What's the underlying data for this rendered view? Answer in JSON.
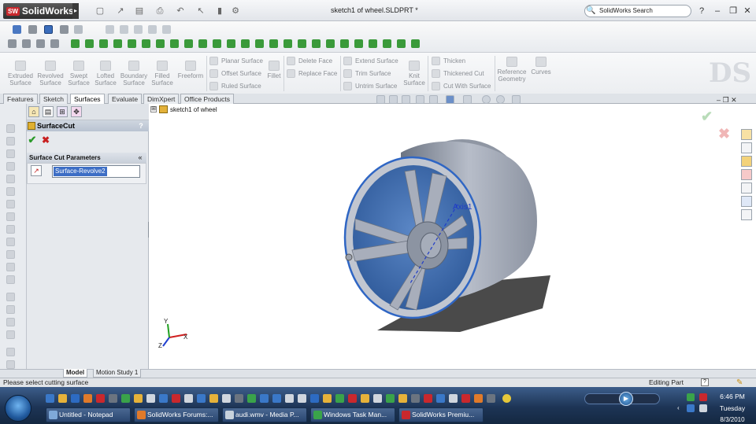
{
  "app": {
    "name": "SolidWorks",
    "badge": "SW"
  },
  "title": {
    "document": "sketch1 of wheel.SLDPRT *"
  },
  "search": {
    "placeholder": "SolidWorks Search"
  },
  "window_buttons": {
    "help": "?",
    "minimize": "–",
    "restore": "❐",
    "close": "✕"
  },
  "commands": {
    "big": [
      {
        "label": "Extruded Surface"
      },
      {
        "label": "Revolved Surface"
      },
      {
        "label": "Swept Surface"
      },
      {
        "label": "Lofted Surface"
      },
      {
        "label": "Boundary Surface"
      },
      {
        "label": "Filled Surface"
      },
      {
        "label": "Freeform"
      }
    ],
    "col1": [
      "Planar Surface",
      "Offset Surface",
      "Ruled Surface"
    ],
    "fillet": "Fillet",
    "col2": [
      "Delete Face",
      "Replace Face"
    ],
    "col3": [
      "Extend Surface",
      "Trim Surface",
      "Untrim Surface"
    ],
    "knit": "Knit Surface",
    "col4": [
      "Thicken",
      "Thickened Cut",
      "Cut With Surface"
    ],
    "reference": "Reference Geometry",
    "curves": "Curves"
  },
  "tabs": [
    "Features",
    "Sketch",
    "Surfaces",
    "Evaluate",
    "DimXpert",
    "Office Products"
  ],
  "active_tab": "Surfaces",
  "property_manager": {
    "title": "SurfaceCut",
    "help": "?",
    "ok": "✔",
    "cancel": "✖",
    "group_title": "Surface Cut Parameters",
    "collapse": "«",
    "selection": "Surface-Revolve2"
  },
  "tree": {
    "label": "sketch1 of wheel",
    "expand": "⊞"
  },
  "viewport": {
    "axis_label": "Axis1",
    "triad": {
      "x": "X",
      "y": "Y",
      "z": "Z"
    }
  },
  "bottom_tabs": [
    "Model",
    "Motion Study 1"
  ],
  "status": {
    "message": "Please select cutting surface",
    "mode": "Editing Part",
    "help": "?"
  },
  "taskbar": {
    "tasks": [
      {
        "label": "Untitled - Notepad",
        "color": "#7fa9d8"
      },
      {
        "label": "SolidWorks Forums:...",
        "color": "#e07a2a"
      },
      {
        "label": "audi.wmv - Media P...",
        "color": "#c8d2dc"
      },
      {
        "label": "Windows Task Man...",
        "color": "#3aa34a"
      },
      {
        "label": "SolidWorks Premiu...",
        "color": "#c9282d"
      }
    ],
    "clock": {
      "time": "6:46 PM",
      "day": "Tuesday",
      "date": "8/3/2010"
    }
  },
  "colors": {
    "wheel_face": "#3f6fb3",
    "wheel_rim": "#b8bdc8",
    "accent": "#3d6ec5"
  }
}
